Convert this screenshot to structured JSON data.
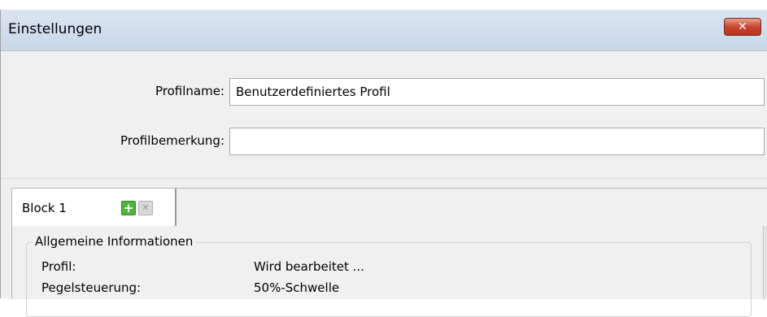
{
  "window": {
    "title": "Einstellungen",
    "close_glyph": "✕"
  },
  "form": {
    "profile_name_label": "Profilname:",
    "profile_name_value": "Benutzerdefiniertes Profil",
    "profile_note_label": "Profilbemerkung:",
    "profile_note_value": ""
  },
  "tabs": [
    {
      "label": "Block 1",
      "add_icon": "plus-icon",
      "remove_icon": "close-icon"
    }
  ],
  "group": {
    "title": "Allgemeine Informationen",
    "rows": [
      {
        "key": "Profil:",
        "value": "Wird bearbeitet ..."
      },
      {
        "key": "Pegelsteuerung:",
        "value": "50%-Schwelle"
      }
    ]
  },
  "colors": {
    "close_button": "#c8452f",
    "add_button": "#4cb83a",
    "titlebar": "#c9d7e8"
  }
}
